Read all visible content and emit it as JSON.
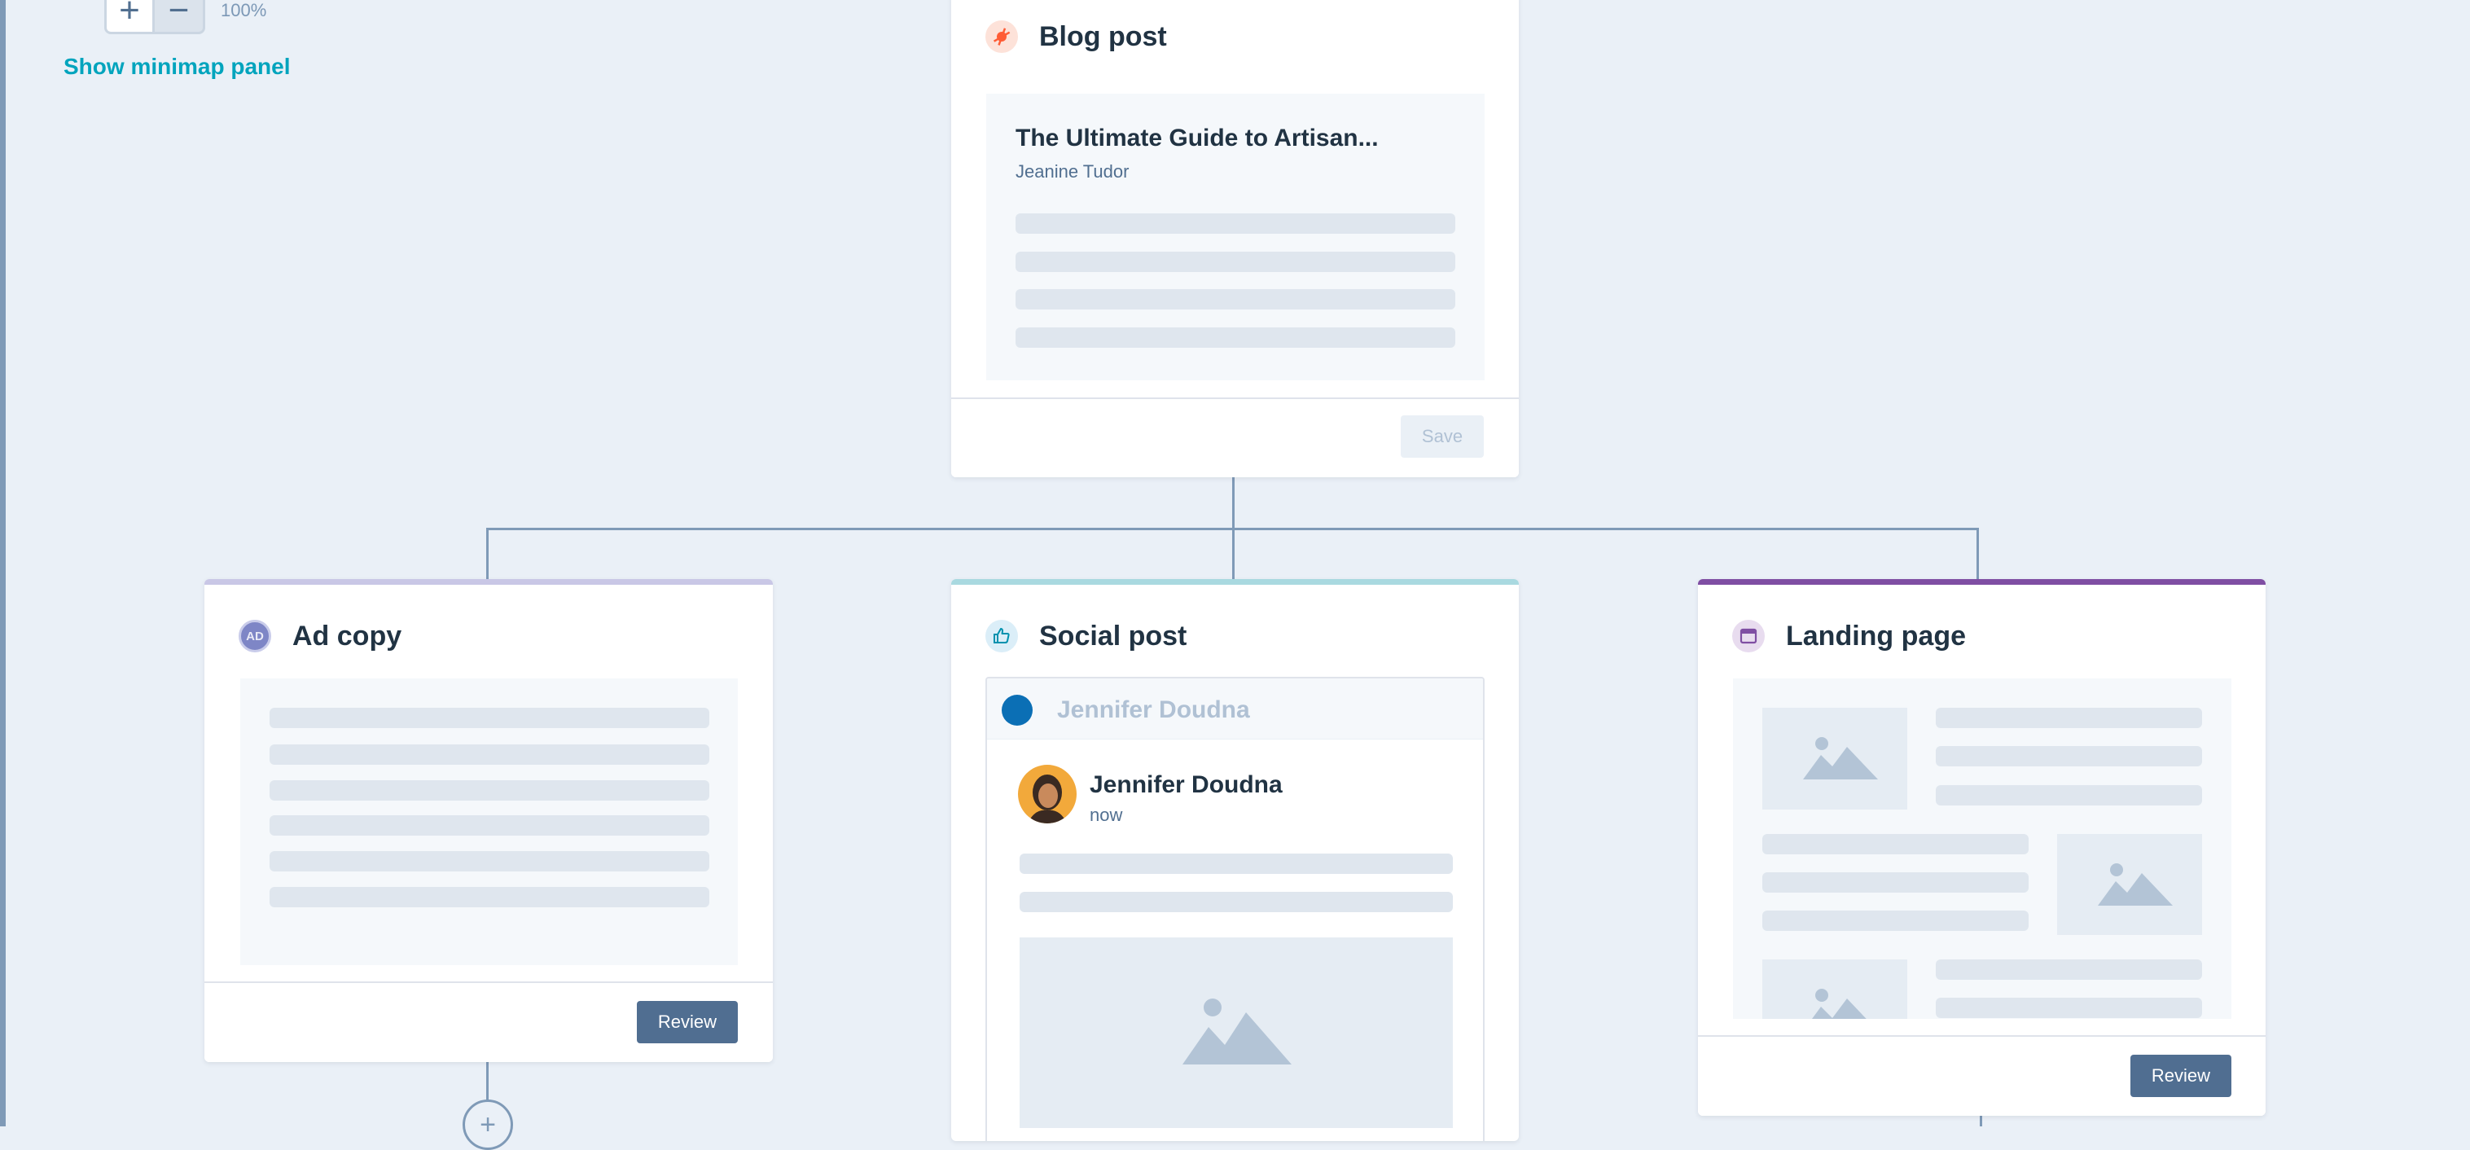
{
  "canvas": {
    "zoom_in_label": "+",
    "zoom_out_label": "−",
    "zoom_level": "100%",
    "minimap_link": "Show minimap panel",
    "add_node_label": "+"
  },
  "blog_post": {
    "title": "Blog post",
    "accent_color": "#ff5c35",
    "icon": "spark-icon",
    "article_title": "The Ultimate Guide to Artisan...",
    "author": "Jeanine Tudor",
    "save_label": "Save"
  },
  "ad_copy": {
    "title": "Ad copy",
    "accent_color": "#c9c7e6",
    "icon_text": "AD",
    "review_label": "Review"
  },
  "social_post": {
    "title": "Social post",
    "accent_color": "#a9d9e0",
    "icon": "thumbs-up-icon",
    "account_name": "Jennifer Doudna",
    "poster_name": "Jennifer Doudna",
    "post_time": "now"
  },
  "landing_page": {
    "title": "Landing page",
    "accent_color": "#7f4ea3",
    "icon": "browser-window-icon",
    "review_label": "Review"
  }
}
